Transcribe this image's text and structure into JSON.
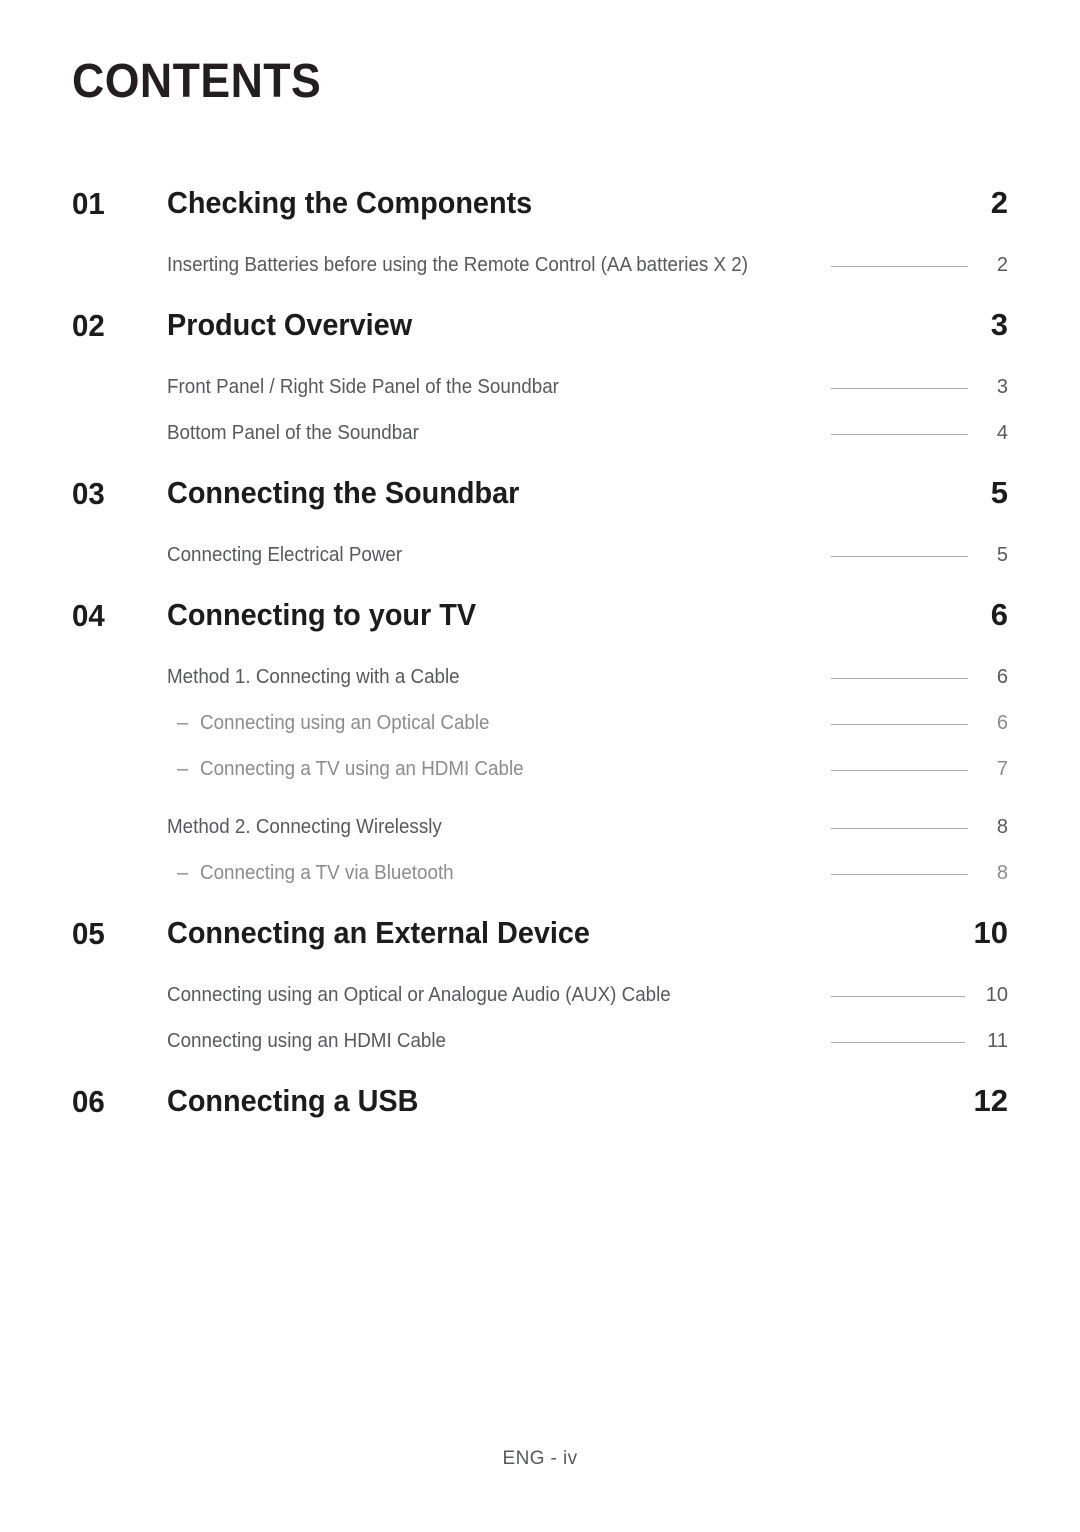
{
  "document": {
    "title": "CONTENTS",
    "footer": "ENG - iv"
  },
  "sections": [
    {
      "number": "01",
      "title": "Checking the Components",
      "page": "2",
      "entries": [
        {
          "label": "Inserting Batteries before using the Remote Control (AA batteries X 2)",
          "page": "2",
          "level": 1
        }
      ]
    },
    {
      "number": "02",
      "title": "Product Overview",
      "page": "3",
      "entries": [
        {
          "label": "Front Panel / Right Side Panel of the Soundbar",
          "page": "3",
          "level": 1
        },
        {
          "label": "Bottom Panel of the Soundbar",
          "page": "4",
          "level": 1
        }
      ]
    },
    {
      "number": "03",
      "title": "Connecting the Soundbar",
      "page": "5",
      "entries": [
        {
          "label": "Connecting Electrical Power",
          "page": "5",
          "level": 1
        }
      ]
    },
    {
      "number": "04",
      "title": "Connecting to your TV",
      "page": "6",
      "entries": [
        {
          "label": "Method 1. Connecting with a Cable",
          "page": "6",
          "level": 1
        },
        {
          "label": "Connecting using an Optical Cable",
          "page": "6",
          "level": 2,
          "dash": "–"
        },
        {
          "label": "Connecting a TV using an HDMI Cable",
          "page": "7",
          "level": 2,
          "dash": "–"
        },
        {
          "label": "Method 2. Connecting Wirelessly",
          "page": "8",
          "level": 1,
          "gap_top": true
        },
        {
          "label": "Connecting a TV via Bluetooth",
          "page": "8",
          "level": 2,
          "dash": "–"
        }
      ]
    },
    {
      "number": "05",
      "title": "Connecting an External Device",
      "page": "10",
      "entries": [
        {
          "label": "Connecting using an Optical or Analogue Audio (AUX) Cable",
          "page": "10",
          "level": 1
        },
        {
          "label": "Connecting using an HDMI Cable",
          "page": "11",
          "level": 1
        }
      ]
    },
    {
      "number": "06",
      "title": "Connecting a USB",
      "page": "12",
      "entries": []
    }
  ],
  "colors": {
    "heading": "#1c1c1c",
    "entry": "#58595b",
    "subentry": "#8c8c8e",
    "leader": "#a9a9ab",
    "background": "#ffffff"
  }
}
